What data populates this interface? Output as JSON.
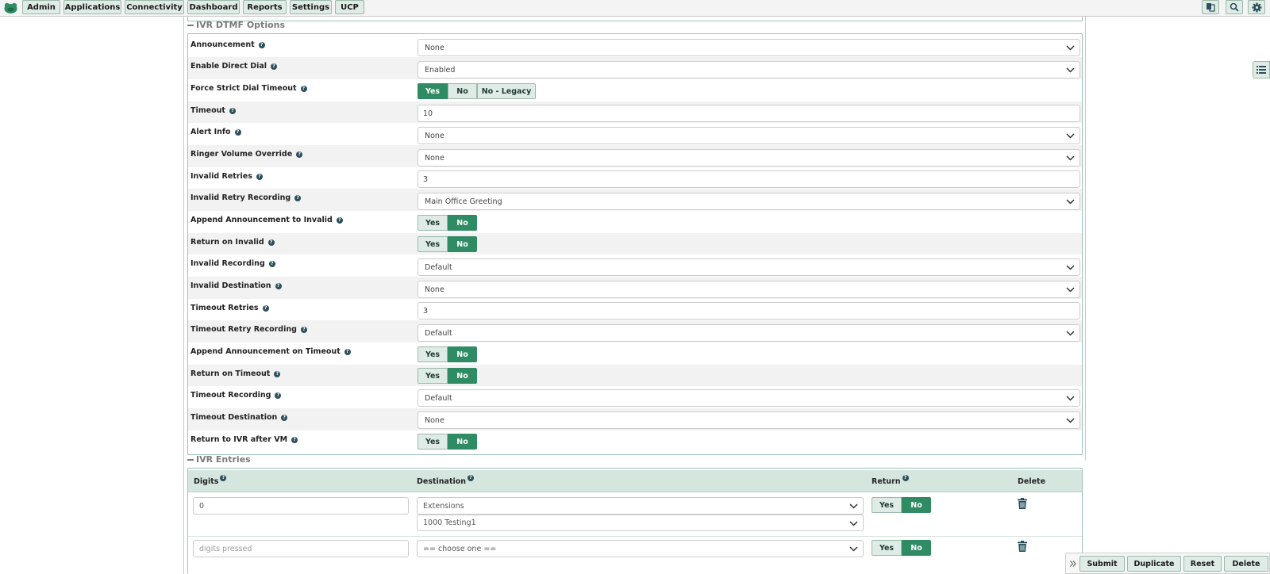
{
  "topbar": {
    "menu": [
      "Admin",
      "Applications",
      "Connectivity",
      "Dashboard",
      "Reports",
      "Settings",
      "UCP"
    ]
  },
  "sections": {
    "dtmf_title": "IVR DTMF Options",
    "entries_title": "IVR Entries"
  },
  "fields": {
    "announcement": {
      "label": "Announcement",
      "value": "None"
    },
    "direct_dial": {
      "label": "Enable Direct Dial",
      "value": "Enabled"
    },
    "strict_timeout": {
      "label": "Force Strict Dial Timeout",
      "options": [
        "Yes",
        "No",
        "No - Legacy"
      ],
      "selected": "Yes"
    },
    "timeout": {
      "label": "Timeout",
      "value": "10"
    },
    "alert_info": {
      "label": "Alert Info",
      "value": "None"
    },
    "ringer_volume": {
      "label": "Ringer Volume Override",
      "value": "None"
    },
    "invalid_retries": {
      "label": "Invalid Retries",
      "value": "3"
    },
    "invalid_retry_recording": {
      "label": "Invalid Retry Recording",
      "value": "Main Office Greeting"
    },
    "append_invalid": {
      "label": "Append Announcement to Invalid",
      "options": [
        "Yes",
        "No"
      ],
      "selected": "No"
    },
    "return_invalid": {
      "label": "Return on Invalid",
      "options": [
        "Yes",
        "No"
      ],
      "selected": "No"
    },
    "invalid_recording": {
      "label": "Invalid Recording",
      "value": "Default"
    },
    "invalid_destination": {
      "label": "Invalid Destination",
      "value": "None"
    },
    "timeout_retries": {
      "label": "Timeout Retries",
      "value": "3"
    },
    "timeout_retry_recording": {
      "label": "Timeout Retry Recording",
      "value": "Default"
    },
    "append_timeout": {
      "label": "Append Announcement on Timeout",
      "options": [
        "Yes",
        "No"
      ],
      "selected": "No"
    },
    "return_timeout": {
      "label": "Return on Timeout",
      "options": [
        "Yes",
        "No"
      ],
      "selected": "No"
    },
    "timeout_recording": {
      "label": "Timeout Recording",
      "value": "Default"
    },
    "timeout_destination": {
      "label": "Timeout Destination",
      "value": "None"
    },
    "return_after_vm": {
      "label": "Return to IVR after VM",
      "options": [
        "Yes",
        "No"
      ],
      "selected": "No"
    }
  },
  "entries": {
    "headers": {
      "digits": "Digits",
      "destination": "Destination",
      "return": "Return",
      "delete": "Delete"
    },
    "rows": [
      {
        "digits": "0",
        "destination": "Extensions",
        "destination_sub": "1000 Testing1",
        "return_options": [
          "Yes",
          "No"
        ],
        "return_selected": "No"
      },
      {
        "digits_placeholder": "digits pressed",
        "destination": "== choose one ==",
        "return_options": [
          "Yes",
          "No"
        ],
        "return_selected": "No"
      }
    ]
  },
  "actions": [
    "Submit",
    "Duplicate",
    "Reset",
    "Delete"
  ],
  "colors": {
    "accent": "#2e8b63",
    "button_bg": "#dfece6",
    "border": "#9cc4b4",
    "header_bg": "#d5e6df"
  },
  "icons": [
    "freepbx-logo-icon",
    "language-icon",
    "search-icon",
    "gear-icon",
    "list-icon",
    "chevron-down-icon",
    "trash-icon",
    "double-chevron-right-icon",
    "help-icon"
  ]
}
